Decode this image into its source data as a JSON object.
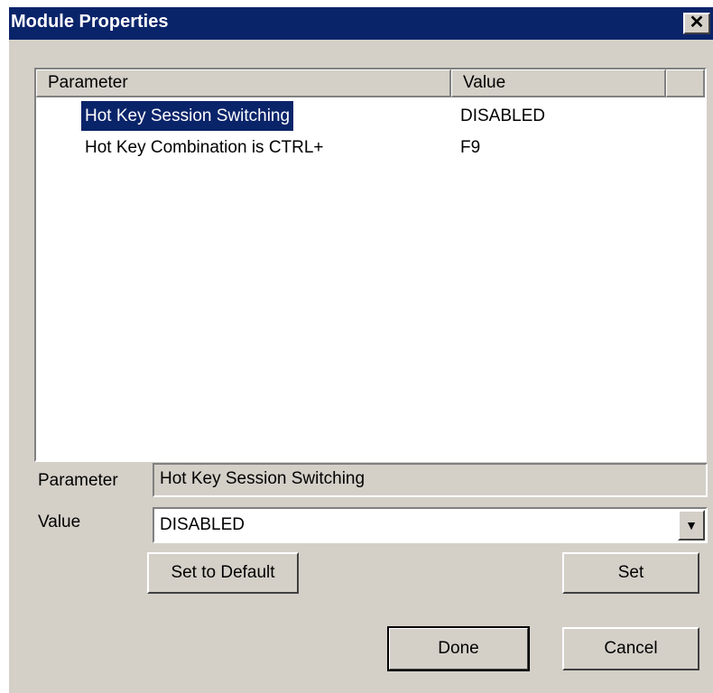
{
  "window": {
    "title": "Module Properties",
    "close_glyph": "✕"
  },
  "list": {
    "columns": [
      "Parameter",
      "Value"
    ],
    "rows": [
      {
        "parameter": "Hot Key Session Switching",
        "value": "DISABLED",
        "selected": true
      },
      {
        "parameter": "Hot Key Combination is CTRL+",
        "value": "F9",
        "selected": false
      }
    ]
  },
  "form": {
    "parameter_label": "Parameter",
    "parameter_value": "Hot Key Session Switching",
    "value_label": "Value",
    "value_selected": "DISABLED",
    "dropdown_glyph": "▼"
  },
  "buttons": {
    "set_default": "Set to Default",
    "set": "Set",
    "done": "Done",
    "cancel": "Cancel"
  },
  "colors": {
    "titlebar": "#0a246a",
    "face": "#d4d0c8",
    "selection": "#0a246a"
  }
}
